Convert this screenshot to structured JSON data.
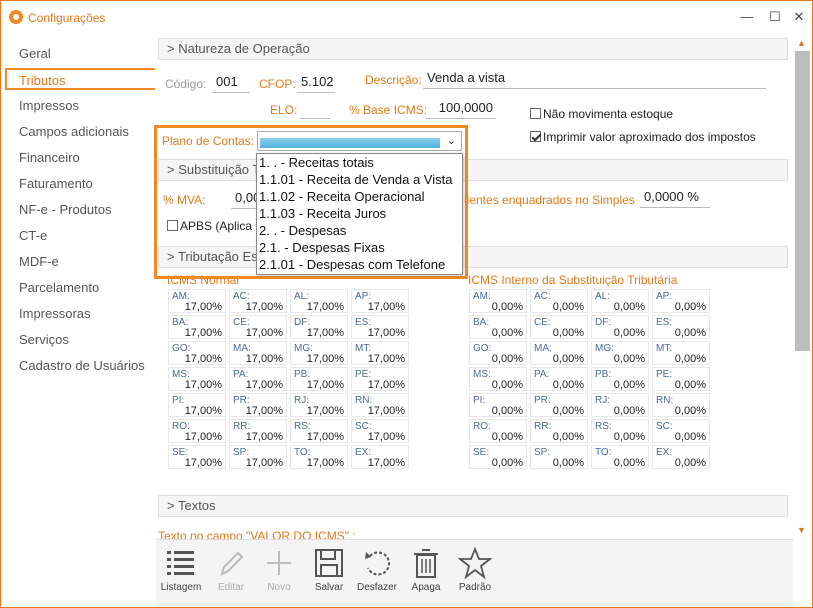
{
  "window": {
    "title": "Configurações",
    "minimize": "—",
    "maximize": "☐",
    "close": "✕"
  },
  "sidebar": {
    "items": [
      {
        "label": "Geral"
      },
      {
        "label": "Tributos"
      },
      {
        "label": "Impressos"
      },
      {
        "label": "Campos adicionais"
      },
      {
        "label": "Financeiro"
      },
      {
        "label": "Faturamento"
      },
      {
        "label": "NF-e - Produtos"
      },
      {
        "label": "CT-e"
      },
      {
        "label": "MDF-e"
      },
      {
        "label": "Parcelamento"
      },
      {
        "label": "Impressoras"
      },
      {
        "label": "Serviços"
      },
      {
        "label": "Cadastro de Usuários"
      }
    ]
  },
  "natureza": {
    "header": "> Natureza de Operação",
    "codigo_label": "Código:",
    "codigo": "001",
    "cfop_label": "CFOP:",
    "cfop": "5.102",
    "descricao_label": "Descrição:",
    "descricao": "Venda a vista",
    "elo_label": "ELO:",
    "elo": "",
    "base_label": "% Base ICMS:",
    "base": "100,0000",
    "nao_mov": "Não movimenta estoque",
    "imprimir": "Imprimir valor aproximado dos impostos"
  },
  "plano": {
    "label": "Plano de Contas:",
    "options": [
      "1. . - Receitas totais",
      "1.1.01 - Receita de Venda a Vista",
      "1.1.02 - Receita Operacional",
      "1.1.03 - Receita Juros",
      "2. . - Despesas",
      "2.1. - Despesas Fixas",
      "2.1.01 - Despesas com Telefone"
    ]
  },
  "subst": {
    "header": "> Substituição T",
    "mva_label": "% MVA:",
    "mva": "0,00",
    "apbs": "APBS (Aplica c",
    "simples_label": "lientes enquadrados no Simples",
    "simples": "0,0000 %"
  },
  "tributacao": {
    "header": "> Tributação Est",
    "icms_label": "ICMS Normal",
    "icms_st_label": "ICMS Interno da Substituição Tributária"
  },
  "icms_normal": [
    {
      "uf": "AM:",
      "v": "17,00%"
    },
    {
      "uf": "AC:",
      "v": "17,00%"
    },
    {
      "uf": "AL:",
      "v": "17,00%"
    },
    {
      "uf": "AP:",
      "v": "17,00%"
    },
    {
      "uf": "BA:",
      "v": "17,00%"
    },
    {
      "uf": "CE:",
      "v": "17,00%"
    },
    {
      "uf": "DF:",
      "v": "17,00%"
    },
    {
      "uf": "ES:",
      "v": "17,00%"
    },
    {
      "uf": "GO:",
      "v": "17,00%"
    },
    {
      "uf": "MA:",
      "v": "17,00%"
    },
    {
      "uf": "MG:",
      "v": "17,00%"
    },
    {
      "uf": "MT:",
      "v": "17,00%"
    },
    {
      "uf": "MS:",
      "v": "17,00%"
    },
    {
      "uf": "PA:",
      "v": "17,00%"
    },
    {
      "uf": "PB:",
      "v": "17,00%"
    },
    {
      "uf": "PE:",
      "v": "17,00%"
    },
    {
      "uf": "PI:",
      "v": "17,00%"
    },
    {
      "uf": "PR:",
      "v": "17,00%"
    },
    {
      "uf": "RJ:",
      "v": "17,00%"
    },
    {
      "uf": "RN:",
      "v": "17,00%"
    },
    {
      "uf": "RO:",
      "v": "17,00%"
    },
    {
      "uf": "RR:",
      "v": "17,00%"
    },
    {
      "uf": "RS:",
      "v": "17,00%"
    },
    {
      "uf": "SC:",
      "v": "17,00%"
    },
    {
      "uf": "SE:",
      "v": "17,00%"
    },
    {
      "uf": "SP:",
      "v": "17,00%"
    },
    {
      "uf": "TO:",
      "v": "17,00%"
    },
    {
      "uf": "EX:",
      "v": "17,00%"
    }
  ],
  "icms_st": [
    {
      "uf": "AM:",
      "v": "0,00%"
    },
    {
      "uf": "AC:",
      "v": "0,00%"
    },
    {
      "uf": "AL:",
      "v": "0,00%"
    },
    {
      "uf": "AP:",
      "v": "0,00%"
    },
    {
      "uf": "BA:",
      "v": "0,00%"
    },
    {
      "uf": "CE:",
      "v": "0,00%"
    },
    {
      "uf": "DF:",
      "v": "0,00%"
    },
    {
      "uf": "ES:",
      "v": "0,00%"
    },
    {
      "uf": "GO:",
      "v": "0,00%"
    },
    {
      "uf": "MA:",
      "v": "0,00%"
    },
    {
      "uf": "MG:",
      "v": "0,00%"
    },
    {
      "uf": "MT:",
      "v": "0,00%"
    },
    {
      "uf": "MS:",
      "v": "0,00%"
    },
    {
      "uf": "PA:",
      "v": "0,00%"
    },
    {
      "uf": "PB:",
      "v": "0,00%"
    },
    {
      "uf": "PE:",
      "v": "0,00%"
    },
    {
      "uf": "PI:",
      "v": "0,00%"
    },
    {
      "uf": "PR:",
      "v": "0,00%"
    },
    {
      "uf": "RJ:",
      "v": "0,00%"
    },
    {
      "uf": "RN:",
      "v": "0,00%"
    },
    {
      "uf": "RO:",
      "v": "0,00%"
    },
    {
      "uf": "RR:",
      "v": "0,00%"
    },
    {
      "uf": "RS:",
      "v": "0,00%"
    },
    {
      "uf": "SC:",
      "v": "0,00%"
    },
    {
      "uf": "SE:",
      "v": "0,00%"
    },
    {
      "uf": "SP:",
      "v": "0,00%"
    },
    {
      "uf": "TO:",
      "v": "0,00%"
    },
    {
      "uf": "EX:",
      "v": "0,00%"
    }
  ],
  "textos": {
    "header": "> Textos",
    "valor_label": "Texto no campo \"VALOR DO ICMS\" :"
  },
  "toolbar": {
    "listagem": "Listagem",
    "editar": "Editar",
    "novo": "Novo",
    "salvar": "Salvar",
    "desfazer": "Desfazer",
    "apaga": "Apaga",
    "padrao": "Padrão"
  },
  "colors": {
    "accent": "#f08a24",
    "accent_text": "#e07a1a"
  }
}
